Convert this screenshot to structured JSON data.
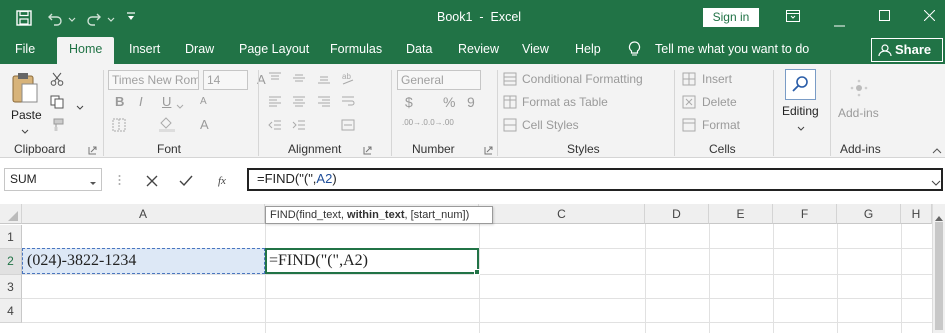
{
  "titlebar": {
    "title": "Book1  -  Excel",
    "sign_in": "Sign in"
  },
  "tabs": [
    "File",
    "Home",
    "Insert",
    "Draw",
    "Page Layout",
    "Formulas",
    "Data",
    "Review",
    "View",
    "Help"
  ],
  "tell_me": "Tell me what you want to do",
  "share": "Share",
  "ribbon": {
    "clipboard": {
      "label": "Clipboard",
      "paste": "Paste"
    },
    "font": {
      "label": "Font",
      "font_name": "Times New Roman",
      "font_size": "14",
      "bold": "B",
      "italic": "I",
      "underline": "U",
      "grow": "A",
      "shrink": "A",
      "color_a": "A"
    },
    "alignment": {
      "label": "Alignment"
    },
    "number": {
      "label": "Number",
      "format": "General",
      "currency": "$",
      "percent": "%",
      "comma": "9",
      "inc_dec": ".00→.0",
      "dec_dec": ".0→.00"
    },
    "styles": {
      "label": "Styles",
      "conditional": "Conditional Formatting",
      "format_table": "Format as Table",
      "cell_styles": "Cell Styles"
    },
    "cells": {
      "label": "Cells",
      "insert": "Insert",
      "delete": "Delete",
      "format": "Format"
    },
    "editing": {
      "label": "Editing"
    },
    "addins": {
      "label": "Add-ins",
      "button": "Add-ins"
    }
  },
  "formula_bar": {
    "name_box": "SUM",
    "formula_prefix": "=FIND(\"(\",",
    "formula_ref": "A2",
    "formula_suffix": ")"
  },
  "tooltip": {
    "pre": "FIND(find_text, ",
    "bold": "within_text",
    "post": ", [start_num])"
  },
  "columns": [
    "A",
    "B",
    "C",
    "D",
    "E",
    "F",
    "G",
    "H"
  ],
  "rows": [
    "1",
    "2",
    "3",
    "4"
  ],
  "cells": {
    "A2": "(024)-3822-1234",
    "B2": "=FIND(\"(\",A2)"
  },
  "colors": {
    "excel_green": "#217346",
    "ref_blue": "#1f4e99"
  }
}
